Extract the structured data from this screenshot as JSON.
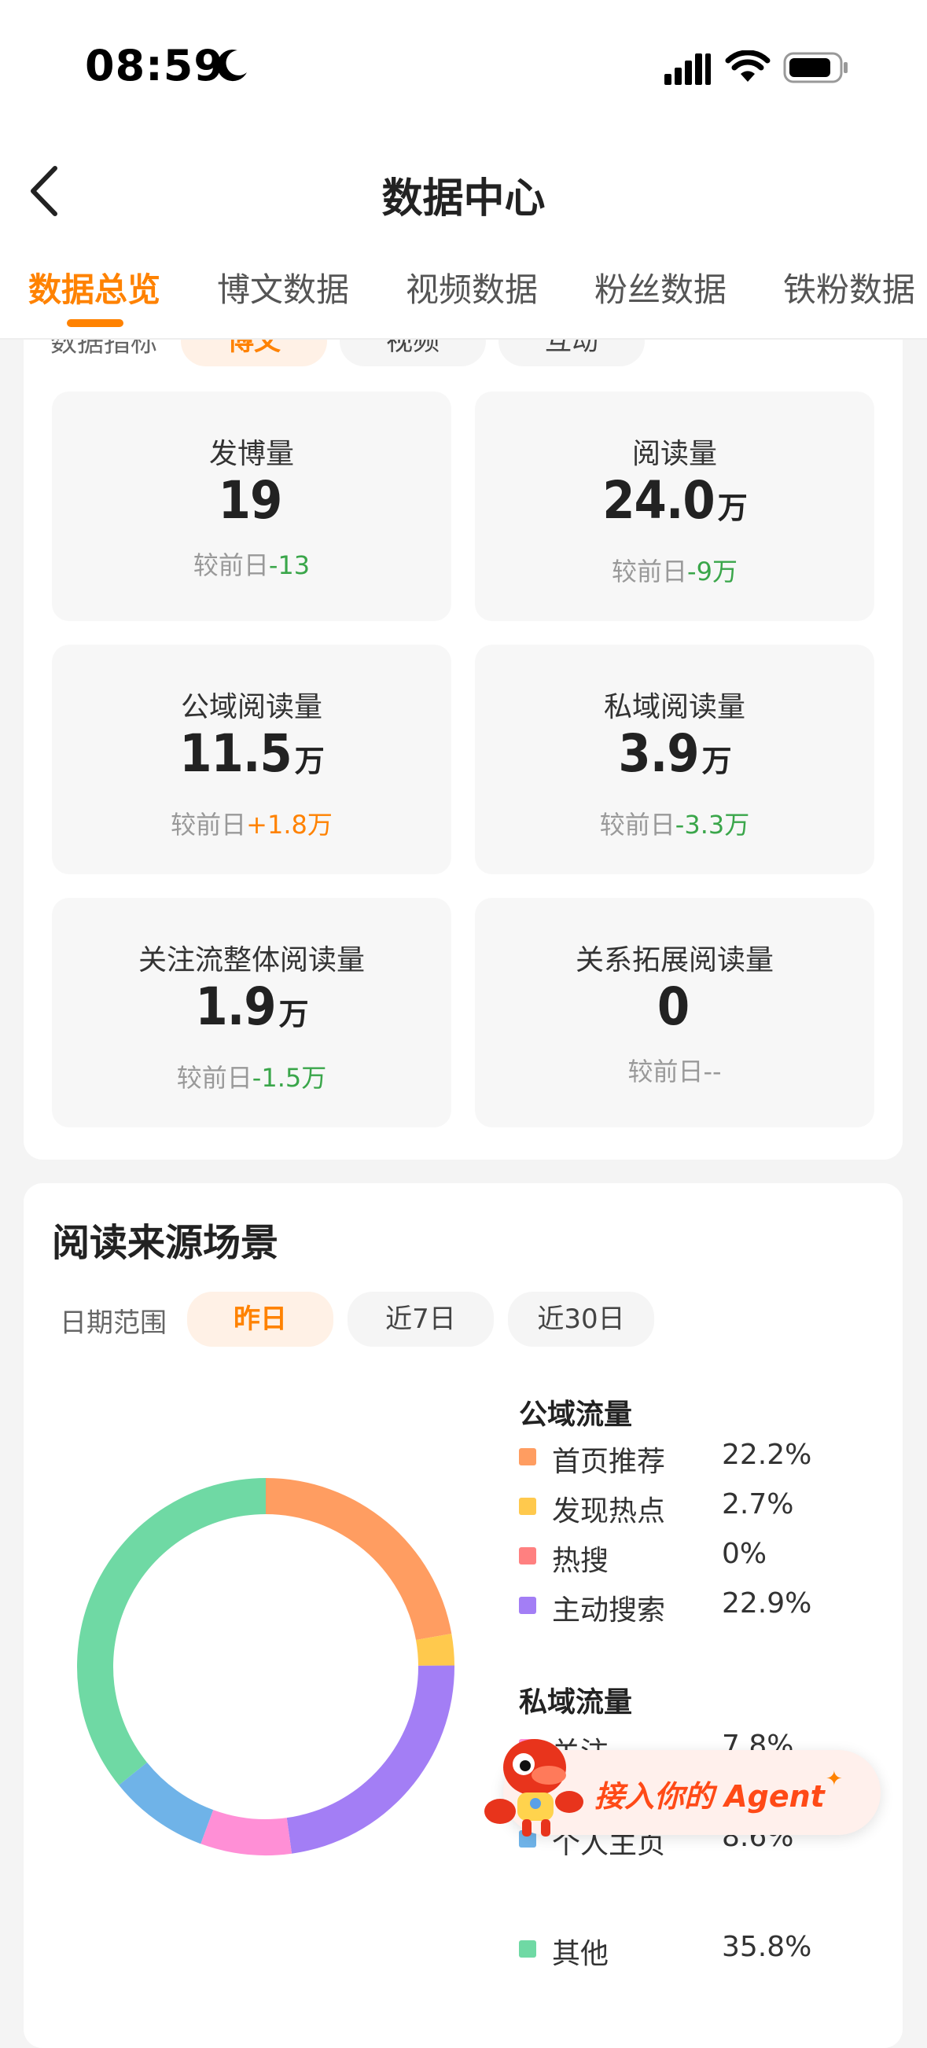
{
  "status_bar": {
    "time": "08:59"
  },
  "nav": {
    "title": "数据中心"
  },
  "tabs": [
    {
      "label": "数据总览",
      "active": true
    },
    {
      "label": "博文数据",
      "active": false
    },
    {
      "label": "视频数据",
      "active": false
    },
    {
      "label": "粉丝数据",
      "active": false
    },
    {
      "label": "铁粉数据",
      "active": false
    }
  ],
  "metrics_filter": {
    "label": "数据指标",
    "chips": [
      {
        "label": "博文",
        "active": true
      },
      {
        "label": "视频",
        "active": false
      },
      {
        "label": "互动",
        "active": false
      }
    ]
  },
  "metrics": [
    {
      "label": "发博量",
      "value": "19",
      "unit": "",
      "compare_prefix": "较前日",
      "compare_value": "-13",
      "trend": "down"
    },
    {
      "label": "阅读量",
      "value": "24.0",
      "unit": "万",
      "compare_prefix": "较前日",
      "compare_value": "-9万",
      "trend": "down"
    },
    {
      "label": "公域阅读量",
      "value": "11.5",
      "unit": "万",
      "compare_prefix": "较前日",
      "compare_value": "+1.8万",
      "trend": "up"
    },
    {
      "label": "私域阅读量",
      "value": "3.9",
      "unit": "万",
      "compare_prefix": "较前日",
      "compare_value": "-3.3万",
      "trend": "down"
    },
    {
      "label": "关注流整体阅读量",
      "value": "1.9",
      "unit": "万",
      "compare_prefix": "较前日",
      "compare_value": "-1.5万",
      "trend": "down"
    },
    {
      "label": "关系拓展阅读量",
      "value": "0",
      "unit": "",
      "compare_prefix": "较前日",
      "compare_value": "--",
      "trend": "none"
    }
  ],
  "read_source": {
    "title": "阅读来源场景",
    "date_label": "日期范围",
    "date_chips": [
      {
        "label": "昨日",
        "active": true
      },
      {
        "label": "近7日",
        "active": false
      },
      {
        "label": "近30日",
        "active": false
      }
    ]
  },
  "legend": {
    "public_title": "公域流量",
    "private_title": "私域流量",
    "items": [
      {
        "name": "首页推荐",
        "value": "22.2%",
        "color": "#ff9d61"
      },
      {
        "name": "发现热点",
        "value": "2.7%",
        "color": "#ffc94d"
      },
      {
        "name": "热搜",
        "value": "0%",
        "color": "#ff8080"
      },
      {
        "name": "主动搜索",
        "value": "22.9%",
        "color": "#a37ef5"
      },
      {
        "name": "关注",
        "value": "7.8%",
        "color": "#ff8fd6"
      },
      {
        "name": "个人主页",
        "value": "8.6%",
        "color": "#6fb3e8"
      },
      {
        "name": "其他",
        "value": "35.8%",
        "color": "#6fd9a4"
      }
    ]
  },
  "chart_data": {
    "type": "pie",
    "style": "donut",
    "categories": [
      "首页推荐",
      "发现热点",
      "热搜",
      "主动搜索",
      "关注",
      "个人主页",
      "其他"
    ],
    "values": [
      22.2,
      2.7,
      0,
      22.9,
      7.8,
      8.6,
      35.8
    ],
    "colors": [
      "#ff9d61",
      "#ffc94d",
      "#ff8080",
      "#a37ef5",
      "#ff8fd6",
      "#6fb3e8",
      "#6fd9a4"
    ],
    "legend_position": "right"
  },
  "agent_banner": {
    "text": "接入你的 Agent"
  },
  "colors": {
    "accent": "#ff8200",
    "down": "#3aa64a",
    "up": "#ff8200"
  },
  "icons": [
    "moon-icon",
    "signal-icon",
    "wifi-icon",
    "battery-icon",
    "back-icon",
    "mascot-icon",
    "sparkle-icon"
  ]
}
